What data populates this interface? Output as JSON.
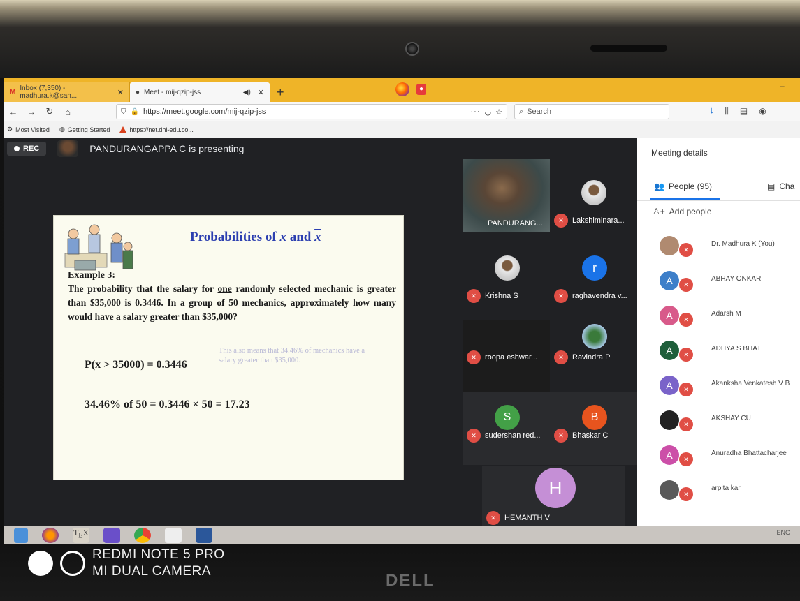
{
  "browser": {
    "tabs": [
      {
        "title": "Inbox (7,350) - madhura.k@san...",
        "active": false
      },
      {
        "title": "Meet - mij-qzip-jss",
        "active": true
      }
    ],
    "new_tab": "+",
    "url": "https://meet.google.com/mij-qzip-jss",
    "search_placeholder": "Search",
    "bookmarks": [
      "Most Visited",
      "Getting Started",
      "https://net.dhi-edu.co..."
    ]
  },
  "meet": {
    "rec_label": "REC",
    "presenting_text": "PANDURANGAPPA C is presenting",
    "slide": {
      "title_prefix": "Probabilities of ",
      "title_x": "x",
      "title_and": " and ",
      "title_xbar": "x",
      "example_label": "Example 3:",
      "problem_pre": "The probability that the salary for ",
      "problem_underlined": "one",
      "problem_post": " randomly selected mechanic is greater than $35,000 is 0.3446.  In a group of 50 mechanics, approximately how many would have a salary greater than $35,000?",
      "equation1": "P(x > 35000) = 0.3446",
      "note": "This also means that 34.46% of mechanics have a salary greater than $35,000.",
      "equation2": "34.46% of 50 = 0.3446 × 50 = 17.23"
    },
    "participants": [
      {
        "name": "PANDURANG...",
        "type": "video"
      },
      {
        "name": "Lakshiminara...",
        "type": "photo"
      },
      {
        "name": "Krishna S",
        "type": "photo"
      },
      {
        "name": "raghavendra v...",
        "initial": "r",
        "color": "#1a73e8"
      },
      {
        "name": "roopa eshwar...",
        "type": "blank"
      },
      {
        "name": "Ravindra P",
        "type": "tree"
      },
      {
        "name": "sudershan red...",
        "initial": "S",
        "color": "#43a047"
      },
      {
        "name": "Bhaskar C",
        "initial": "B",
        "color": "#e8541e"
      },
      {
        "name": "HEMANTH V",
        "initial": "H",
        "color": "#c58fd6"
      }
    ]
  },
  "panel": {
    "title": "Meeting details",
    "people_tab": "People (95)",
    "chat_tab": "Cha",
    "add_people": "Add people",
    "people": [
      {
        "name": "Dr. Madhura K (You)",
        "initial": "",
        "color": "#b08a70"
      },
      {
        "name": "ABHAY ONKAR",
        "initial": "A",
        "color": "#3d7fc9"
      },
      {
        "name": "Adarsh M",
        "initial": "A",
        "color": "#d85a8a"
      },
      {
        "name": "ADHYA S BHAT",
        "initial": "A",
        "color": "#1e5e3a"
      },
      {
        "name": "Akanksha Venkatesh V B",
        "initial": "A",
        "color": "#7a63c9"
      },
      {
        "name": "AKSHAY CU",
        "initial": "",
        "color": "#222222"
      },
      {
        "name": "Anuradha Bhattacharjee",
        "initial": "A",
        "color": "#cc4fa8"
      },
      {
        "name": "arpita kar",
        "initial": "",
        "color": "#5a5a5a"
      }
    ]
  },
  "taskbar": {
    "tray_text": "ENG"
  },
  "watermark": {
    "line1": "REDMI NOTE 5 PRO",
    "line2": "MI DUAL CAMERA"
  },
  "bezel_logo": "DELL"
}
